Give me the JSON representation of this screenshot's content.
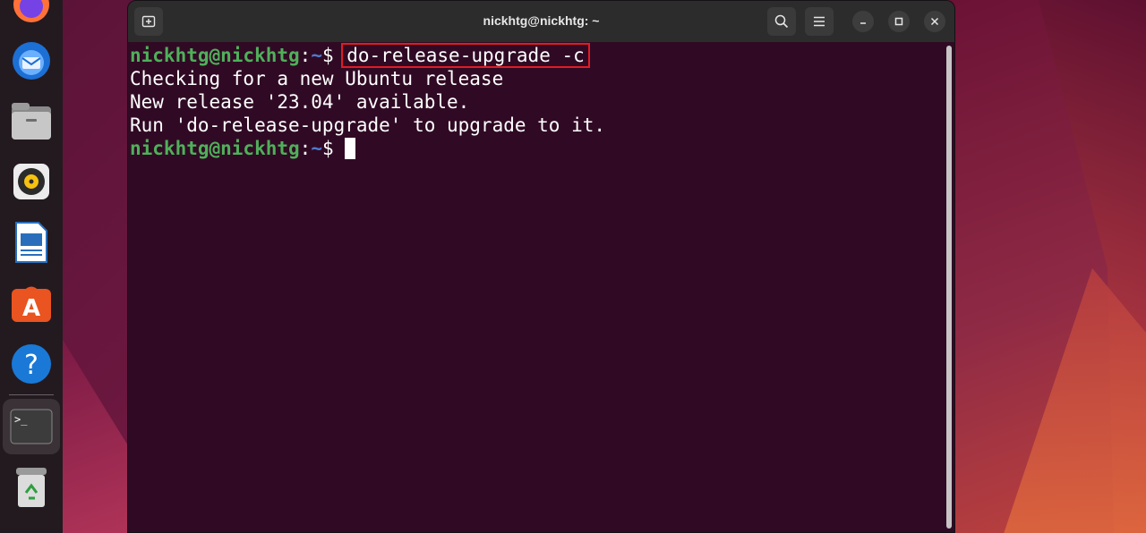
{
  "window": {
    "title": "nickhtg@nickhtg: ~"
  },
  "dock": {
    "items": [
      {
        "name": "firefox-icon"
      },
      {
        "name": "thunderbird-icon"
      },
      {
        "name": "files-icon"
      },
      {
        "name": "rhythmbox-icon"
      },
      {
        "name": "libreoffice-writer-icon"
      },
      {
        "name": "app-center-icon"
      },
      {
        "name": "help-icon"
      },
      {
        "name": "terminal-icon"
      },
      {
        "name": "trash-icon"
      }
    ],
    "terminal_glyph": ">_",
    "help_glyph": "?",
    "store_glyph": "A"
  },
  "terminal": {
    "line1": {
      "user": "nickhtg@nickhtg",
      "sep": ":",
      "path": "~",
      "dollar": "$ ",
      "command": "do-release-upgrade -c"
    },
    "line2": "Checking for a new Ubuntu release",
    "line3": "New release '23.04' available.",
    "line4": "Run 'do-release-upgrade' to upgrade to it.",
    "line5": {
      "user": "nickhtg@nickhtg",
      "sep": ":",
      "path": "~",
      "dollar": "$ "
    }
  },
  "colors": {
    "terminal_bg": "#300a24",
    "prompt_user": "#4fb05a",
    "prompt_path": "#4d7bd0",
    "highlight_box": "#e01b24",
    "ubuntu_orange": "#e95420"
  }
}
